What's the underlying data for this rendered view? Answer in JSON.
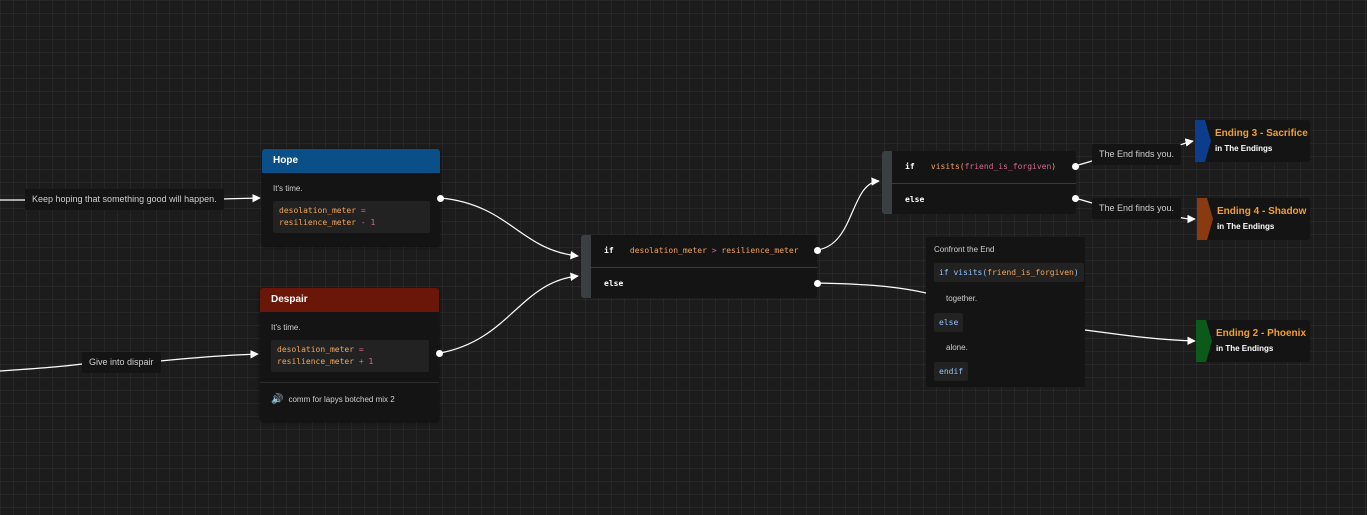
{
  "labels": {
    "keep_hoping": "Keep hoping that something good will happen.",
    "give_into_despair": "Give into dispair",
    "end_finds_1": "The End finds you.",
    "end_finds_2": "The End finds you."
  },
  "hope_node": {
    "title": "Hope",
    "text": "It's time.",
    "code_line1_var": "desolation_meter",
    "code_line1_op": "=",
    "code_line2_var": "resilience_meter",
    "code_line2_op": "-",
    "code_line2_num": "1",
    "color": "#0a4f87"
  },
  "despair_node": {
    "title": "Despair",
    "text": "It's time.",
    "code_line1_var": "desolation_meter",
    "code_line1_op": "=",
    "code_line2_var": "resilience_meter",
    "code_line2_op": "+",
    "code_line2_num": "1",
    "audio_icon": "audio-icon",
    "audio_label": "comm for lapys botched mix 2",
    "color": "#6a1608"
  },
  "branch_main": {
    "if_kw": "if",
    "cond_left": "desolation_meter",
    "cond_op": ">",
    "cond_right": "resilience_meter",
    "else_kw": "else"
  },
  "branch_forgiven": {
    "if_kw": "if",
    "cond_fn": "visits(",
    "cond_arg": "friend_is_forgiven",
    "cond_close": ")",
    "else_kw": "else"
  },
  "confront_card": {
    "title": "Confront the End",
    "if_chip": "if visits(",
    "if_arg": "friend_is_forgiven",
    "if_close": ")",
    "line_together": "together.",
    "else_chip": "else",
    "line_alone": "alone.",
    "endif_chip": "endif"
  },
  "endings": [
    {
      "title": "Ending 3 - Sacrifice",
      "sub": "in The Endings",
      "color": "#0b3d8c"
    },
    {
      "title": "Ending 4 - Shadow",
      "sub": "in The Endings",
      "color": "#8a3a10"
    },
    {
      "title": "Ending 2 - Phoenix",
      "sub": "in The Endings",
      "color": "#0c5a1a"
    }
  ]
}
